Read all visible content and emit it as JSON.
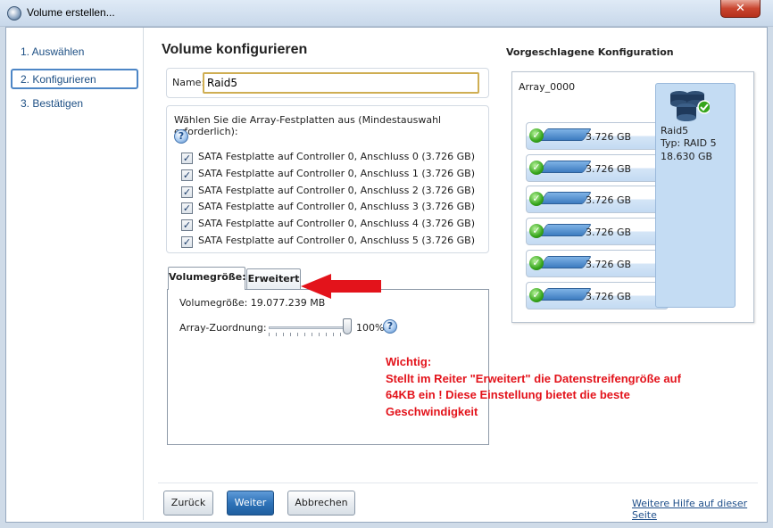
{
  "window": {
    "title": "Volume erstellen...",
    "close_glyph": "✕"
  },
  "sidebar": {
    "items": [
      {
        "label": "1. Auswählen"
      },
      {
        "label": "2. Konfigurieren"
      },
      {
        "label": "3. Bestätigen"
      }
    ],
    "active_index": 1
  },
  "main": {
    "heading": "Volume konfigurieren",
    "name_label": "Name:",
    "name_value": "Raid5",
    "disks_label": "Wählen Sie die Array-Festplatten aus (Mindestauswahl erforderlich):",
    "help_glyph": "?",
    "disks": [
      {
        "label": "SATA Festplatte auf Controller 0, Anschluss 0 (3.726 GB)",
        "checked": true
      },
      {
        "label": "SATA Festplatte auf Controller 0, Anschluss 1 (3.726 GB)",
        "checked": true
      },
      {
        "label": "SATA Festplatte auf Controller 0, Anschluss 2 (3.726 GB)",
        "checked": true
      },
      {
        "label": "SATA Festplatte auf Controller 0, Anschluss 3 (3.726 GB)",
        "checked": true
      },
      {
        "label": "SATA Festplatte auf Controller 0, Anschluss 4 (3.726 GB)",
        "checked": true
      },
      {
        "label": "SATA Festplatte auf Controller 0, Anschluss 5 (3.726 GB)",
        "checked": true
      }
    ],
    "check_glyph": "✓",
    "tabs": [
      {
        "label": "Volumegröße:"
      },
      {
        "label": "Erweitert"
      }
    ],
    "volume_size_text": "Volumegröße: 19.077.239 MB",
    "array_allocation_label": "Array-Zuordnung:",
    "array_allocation_percent": 100,
    "array_allocation_text": "100%",
    "note": {
      "line1": "Wichtig:",
      "line2": "Stellt im Reiter \"Erweitert\" die Datenstreifengröße auf",
      "line3": "64KB ein ! Diese Einstellung bietet die beste",
      "line4": "Geschwindigkeit"
    },
    "annotation_color": "#e3131b"
  },
  "config": {
    "title": "Vorgeschlagene Konfiguration",
    "array_name": "Array_0000",
    "disk_capacity": "3.726 GB",
    "disk_count": 6,
    "raid": {
      "name": "Raid5",
      "type": "Typ: RAID 5",
      "size": "18.630 GB"
    }
  },
  "footer": {
    "back_label": "Zurück",
    "next_label": "Weiter",
    "cancel_label": "Abbrechen",
    "help_link": "Weitere Hilfe auf dieser Seite"
  },
  "colors": {
    "accent": "#2f73b9",
    "link": "#1f4f8a",
    "ok_green": "#36a51b"
  }
}
